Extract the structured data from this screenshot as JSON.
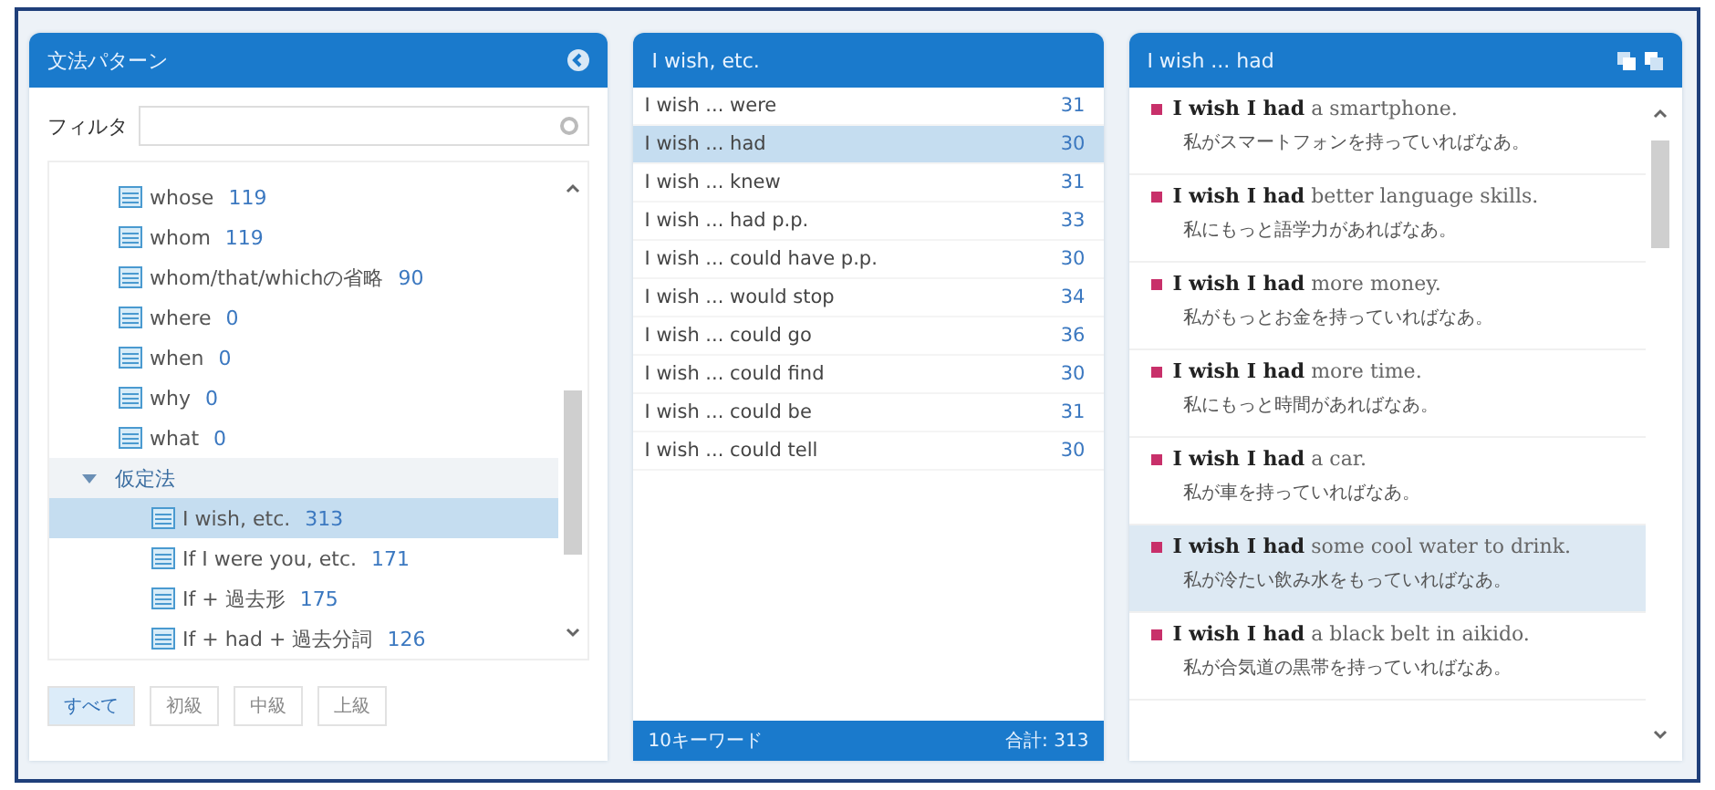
{
  "left_panel": {
    "title": "文法パターン",
    "filter": {
      "label": "フィルタ"
    },
    "tree": [
      {
        "kind": "leaf",
        "label": "whose",
        "count": "119",
        "selected": false
      },
      {
        "kind": "leaf",
        "label": "whom",
        "count": "119",
        "selected": false
      },
      {
        "kind": "leaf",
        "label": "whom/that/whichの省略",
        "count": "90",
        "selected": false
      },
      {
        "kind": "leaf",
        "label": "where",
        "count": "0",
        "selected": false
      },
      {
        "kind": "leaf",
        "label": "when",
        "count": "0",
        "selected": false
      },
      {
        "kind": "leaf",
        "label": "why",
        "count": "0",
        "selected": false
      },
      {
        "kind": "leaf",
        "label": "what",
        "count": "0",
        "selected": false
      },
      {
        "kind": "group",
        "label": "仮定法",
        "expanded": true,
        "children": [
          {
            "kind": "leaf",
            "label": "I wish, etc.",
            "count": "313",
            "selected": true
          },
          {
            "kind": "leaf",
            "label": "If I were you, etc.",
            "count": "171",
            "selected": false
          },
          {
            "kind": "leaf",
            "label": "If + 過去形",
            "count": "175",
            "selected": false
          },
          {
            "kind": "leaf",
            "label": "If + had + 過去分詞",
            "count": "126",
            "selected": false
          }
        ]
      }
    ],
    "levels": [
      {
        "label": "すべて",
        "selected": true
      },
      {
        "label": "初級",
        "selected": false
      },
      {
        "label": "中級",
        "selected": false
      },
      {
        "label": "上級",
        "selected": false
      }
    ]
  },
  "middle_panel": {
    "title": "I wish, etc.",
    "rows": [
      {
        "label": "I wish ... were",
        "count": "31",
        "selected": false
      },
      {
        "label": "I wish ... had",
        "count": "30",
        "selected": true
      },
      {
        "label": "I wish ... knew",
        "count": "31",
        "selected": false
      },
      {
        "label": "I wish ... had p.p.",
        "count": "33",
        "selected": false
      },
      {
        "label": "I wish ... could have p.p.",
        "count": "30",
        "selected": false
      },
      {
        "label": "I wish ... would stop",
        "count": "34",
        "selected": false
      },
      {
        "label": "I wish ... could go",
        "count": "36",
        "selected": false
      },
      {
        "label": "I wish ... could find",
        "count": "30",
        "selected": false
      },
      {
        "label": "I wish ... could be",
        "count": "31",
        "selected": false
      },
      {
        "label": "I wish ... could tell",
        "count": "30",
        "selected": false
      }
    ],
    "footer": {
      "keywords": "10キーワード",
      "total": "合計: 313"
    }
  },
  "right_panel": {
    "title": "I wish ... had",
    "sentences": [
      {
        "english": "**I wish I had** a smartphone.",
        "japanese": "私がスマートフォンを持っていればなあ。",
        "selected": false
      },
      {
        "english": "**I wish I had** better language skills.",
        "japanese": "私にもっと語学力があればなあ。",
        "selected": false
      },
      {
        "english": "**I wish I had** more money.",
        "japanese": "私がもっとお金を持っていればなあ。",
        "selected": false
      },
      {
        "english": "**I wish I had** more time.",
        "japanese": "私にもっと時間があればなあ。",
        "selected": false
      },
      {
        "english": "**I wish I had** a car.",
        "japanese": "私が車を持っていればなあ。",
        "selected": false
      },
      {
        "english": "**I wish I had** some cool water to drink.",
        "japanese": "私が冷たい飲み水をもっていればなあ。",
        "selected": true
      },
      {
        "english": "**I wish I had** a black belt in aikido.",
        "japanese": "私が合気道の黒帯を持っていればなあ。",
        "selected": false
      }
    ]
  }
}
